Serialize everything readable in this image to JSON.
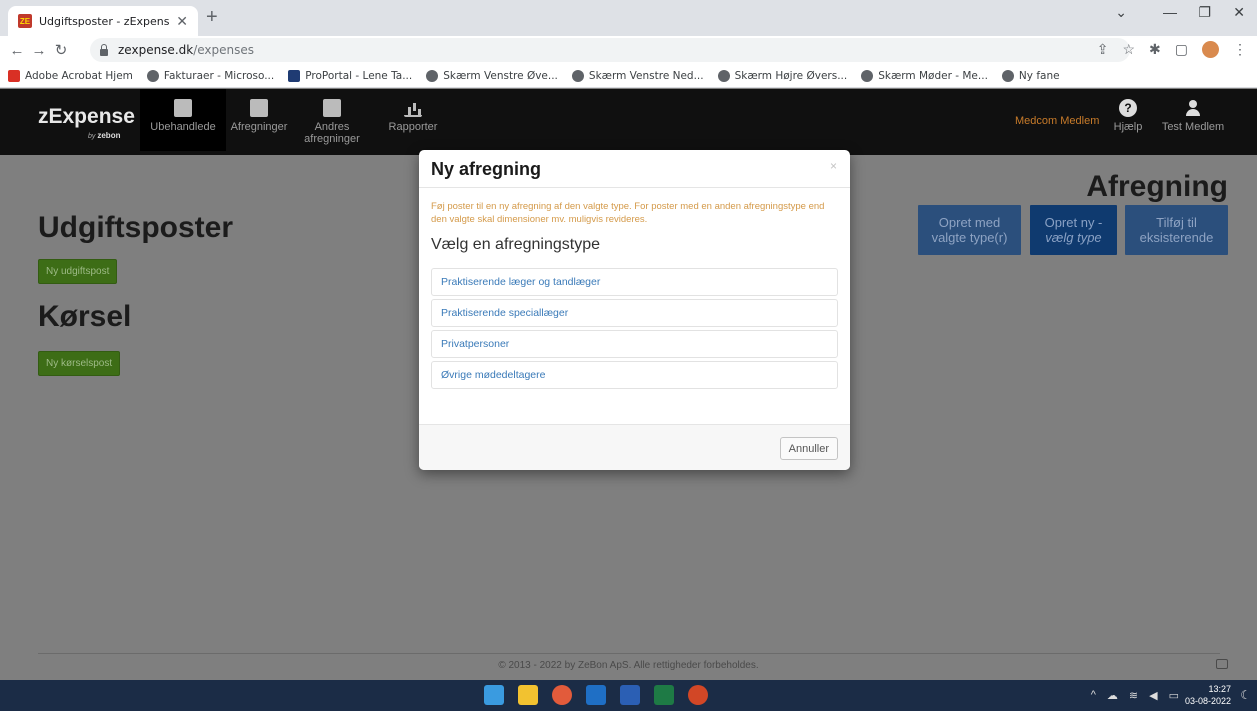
{
  "browser": {
    "tab_title": "Udgiftsposter - zExpense",
    "tab_favicon_text": "ZE",
    "url_host": "zexpense.dk",
    "url_path": "/expenses",
    "bookmarks": [
      {
        "label": "Adobe Acrobat Hjem",
        "icon": "pdf"
      },
      {
        "label": "Fakturaer - Microso...",
        "icon": "globe"
      },
      {
        "label": "ProPortal - Lene Ta...",
        "icon": "navy"
      },
      {
        "label": "Skærm Venstre Øve...",
        "icon": "globe"
      },
      {
        "label": "Skærm Venstre Ned...",
        "icon": "globe"
      },
      {
        "label": "Skærm Højre Øvers...",
        "icon": "globe"
      },
      {
        "label": "Skærm Møder - Me...",
        "icon": "globe"
      },
      {
        "label": "Ny fane",
        "icon": "globe"
      }
    ]
  },
  "navbar": {
    "logo": "zExpense",
    "logo_by": "by",
    "logo_brand": "zebon",
    "items": [
      {
        "label": "Ubehandlede",
        "icon": "inbox-icon",
        "active": true
      },
      {
        "label": "Afregninger",
        "icon": "document-icon",
        "active": false
      },
      {
        "label": "Andres afregninger",
        "icon": "documents-icon",
        "active": false
      },
      {
        "label": "Rapporter",
        "icon": "chart-icon",
        "active": false
      }
    ],
    "org": "Medcom Medlem",
    "help": "Hjælp",
    "user": "Test Medlem"
  },
  "page": {
    "udgift_heading": "Udgiftsposter",
    "udgift_button": "Ny udgiftspost",
    "korsel_heading": "Kørsel",
    "korsel_button": "Ny kørselspost",
    "afregning_heading": "Afregning",
    "afregning_buttons": {
      "opret_med_1": "Opret med",
      "opret_med_2": "valgte type(r)",
      "opret_ny_1": "Opret ny -",
      "opret_ny_2": "vælg type",
      "tilfoej_1": "Tilføj til",
      "tilfoej_2": "eksisterende"
    },
    "footer": "© 2013 - 2022 by ZeBon ApS. Alle rettigheder forbeholdes."
  },
  "modal": {
    "title": "Ny afregning",
    "close": "×",
    "note": "Føj poster til en ny afregning af den valgte type. For poster med en anden afregningstype end den valgte skal dimensioner mv. muligvis revideres.",
    "subtitle": "Vælg en afregningstype",
    "types": [
      "Praktiserende læger og tandlæger",
      "Praktiserende speciallæger",
      "Privatpersoner",
      "Øvrige mødedeltagere"
    ],
    "cancel": "Annuller"
  },
  "taskbar": {
    "time": "13:27",
    "date": "03-08-2022"
  }
}
